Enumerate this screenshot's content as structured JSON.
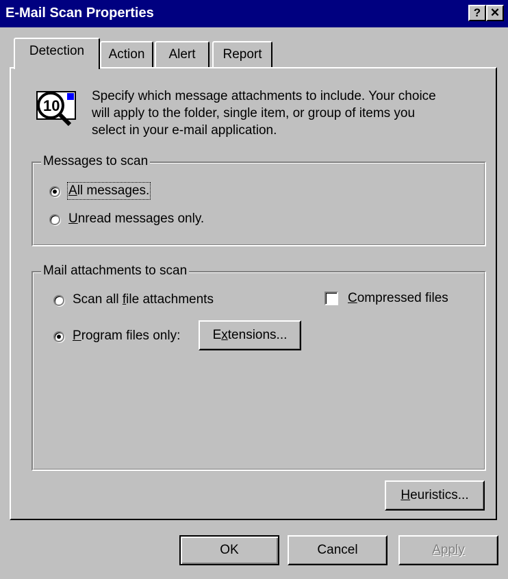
{
  "window": {
    "title": "E-Mail Scan Properties",
    "help_glyph": "?",
    "close_glyph": "✕"
  },
  "tabs": [
    {
      "label": "Detection"
    },
    {
      "label": "Action"
    },
    {
      "label": "Alert"
    },
    {
      "label": "Report"
    }
  ],
  "description": {
    "lines": [
      "Specify which message attachments to include. Your choice",
      "will apply to the folder, single item, or group of items you",
      "select in your e-mail application."
    ]
  },
  "messages_group": {
    "legend": "Messages to scan",
    "options": [
      {
        "label": "All messages.",
        "selected": true
      },
      {
        "label": "Unread messages only.",
        "selected": false
      }
    ]
  },
  "attachments_group": {
    "legend": "Mail attachments to scan",
    "options": [
      {
        "label": "Scan all file attachments",
        "selected": false
      },
      {
        "label": "Program files only:",
        "selected": true
      }
    ],
    "extensions_button": "Extensions...",
    "compressed_checkbox": {
      "label": "Compressed files",
      "checked": false
    }
  },
  "heuristics_button": "Heuristics...",
  "footer": {
    "ok": "OK",
    "cancel": "Cancel",
    "apply": "Apply"
  }
}
